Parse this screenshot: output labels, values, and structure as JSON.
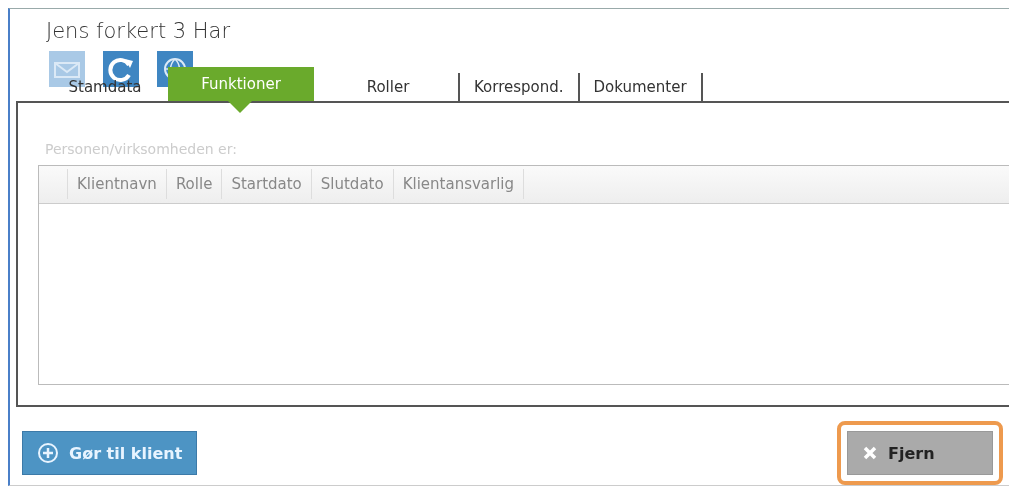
{
  "window": {
    "title": "Jens forkert 3 Har"
  },
  "tabs": [
    {
      "label": "Stamdata",
      "selected": false
    },
    {
      "label": "Funktioner",
      "selected": true
    },
    {
      "label": "Roller",
      "selected": false
    },
    {
      "label": "Korrespond.",
      "selected": false
    },
    {
      "label": "Dokumenter",
      "selected": false
    }
  ],
  "panel": {
    "label": "Personen/virksomheden er:"
  },
  "table": {
    "columns": [
      "Klientnavn",
      "Rolle",
      "Startdato",
      "Slutdato",
      "Klientansvarlig"
    ]
  },
  "buttons": [
    {
      "label": "Gør til klient",
      "kind": "add",
      "highlighted": false
    },
    {
      "label": "Fjern",
      "kind": "remove",
      "highlighted": true
    }
  ]
}
